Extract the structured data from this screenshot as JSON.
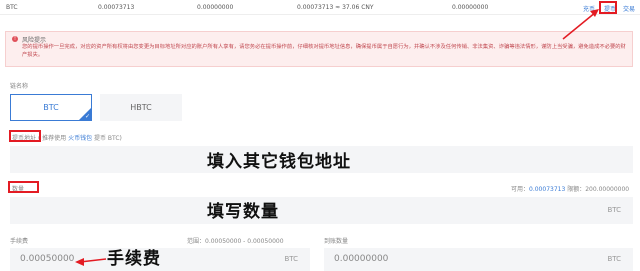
{
  "top_row": {
    "coin": "BTC",
    "total": "0.00073713",
    "frozen": "0.00000000",
    "available_cny": "0.00073713 ≈ 37.06 CNY",
    "other": "0.00000000",
    "actions": [
      "充币",
      "提币",
      "交易"
    ]
  },
  "risk_notice": {
    "title": "风险提示",
    "body": "您的提币操作一旦完成，对应的资产所有权将由您变更为目标地址所对应的账户所有人享有，请您务必在提币操作前，仔细核对提币地址信息，确保提币属于自愿行为，并确认不涉及任何传销、非法集资、诈骗等违法情形，谨防上当受骗，避免造成不必要的财产损失。"
  },
  "chain": {
    "label": "链名称",
    "options": [
      "BTC",
      "HBTC"
    ],
    "selected": "BTC"
  },
  "address": {
    "label": "提币地址",
    "hint_prefix": "( 推荐使用 ",
    "hint_link": "火币钱包",
    "hint_suffix": " 提币 BTC)",
    "value": ""
  },
  "amount": {
    "label": "数量",
    "available_label": "可用：",
    "available_value": "0.00073713",
    "limit_label": "限额：",
    "limit_value": "200.00000000",
    "unit": "BTC",
    "value": ""
  },
  "fee": {
    "label": "手续费",
    "range_label": "范围：",
    "range_value": "0.00050000 - 0.00050000",
    "value": "0.00050000",
    "unit": "BTC"
  },
  "received": {
    "label": "到账数量",
    "value": "0.00000000",
    "unit": "BTC"
  },
  "annotations": {
    "address": "填入其它钱包地址",
    "amount": "填写数量",
    "fee": "手续费"
  },
  "colors": {
    "accent": "#3a7bd5",
    "highlight": "#e31b23",
    "risk_bg": "#fdeeee",
    "field_bg": "#f4f5f7"
  }
}
